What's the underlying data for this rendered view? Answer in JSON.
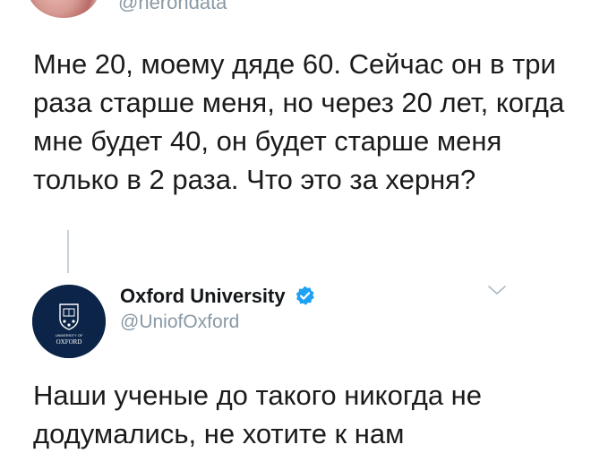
{
  "top_tweet": {
    "handle": "@herondata",
    "text": "Мне 20, моему дяде 60. Сейчас он в три раза старше меня, но через 20 лет, когда мне будет 40, он будет старше меня только в 2 раза. Что это за херня?"
  },
  "reply": {
    "display_name": "Oxford University",
    "handle": "@UniofOxford",
    "avatar_text": {
      "top": "UNIVERSITY OF",
      "bottom": "OXFORD"
    },
    "text": "Наши ученые до такого никогда не додумались, не хотите к нам"
  },
  "icons": {
    "verified": "verified-badge-icon",
    "chevron": "chevron-down-icon",
    "oxford_crest": "oxford-crest-icon"
  },
  "colors": {
    "verified_blue": "#1da1f2",
    "oxford_navy": "#0b2448",
    "handle_gray": "#8899a6"
  }
}
